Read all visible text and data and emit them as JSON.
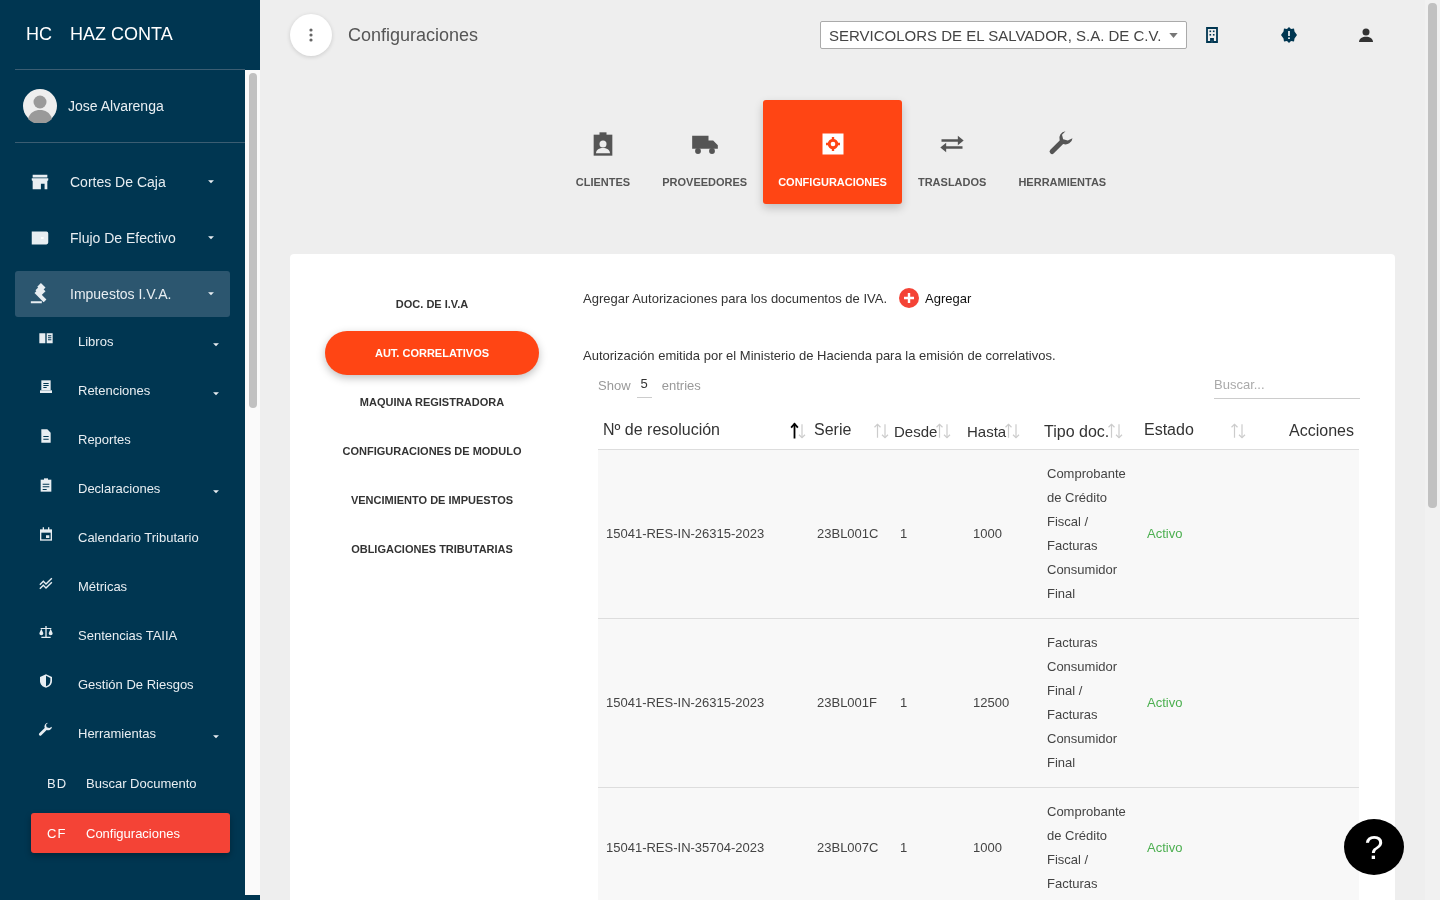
{
  "sidebar": {
    "brand": {
      "abbr": "HC",
      "name": "HAZ CONTA"
    },
    "user": {
      "name": "Jose Alvarenga"
    },
    "menu": [
      {
        "label": "Cortes De Caja",
        "expandable": true,
        "selected": false
      },
      {
        "label": "Flujo De Efectivo",
        "expandable": true,
        "selected": false
      },
      {
        "label": "Impuestos I.V.A.",
        "expandable": true,
        "selected": true,
        "children": [
          {
            "label": "Libros",
            "expandable": true,
            "selected": false
          },
          {
            "label": "Retenciones",
            "expandable": true,
            "selected": false
          },
          {
            "label": "Reportes",
            "expandable": false,
            "selected": false
          },
          {
            "label": "Declaraciones",
            "expandable": true,
            "selected": false
          },
          {
            "label": "Calendario Tributario",
            "expandable": false,
            "selected": false
          },
          {
            "label": "Métricas",
            "expandable": false,
            "selected": false
          },
          {
            "label": "Sentencias TAIIA",
            "expandable": false,
            "selected": false
          },
          {
            "label": "Gestión De Riesgos",
            "expandable": false,
            "selected": false
          },
          {
            "label": "Herramientas",
            "expandable": true,
            "selected": false,
            "children": [
              {
                "abbr": "BD",
                "label": "Buscar Documento",
                "selected": false
              },
              {
                "abbr": "CF",
                "label": "Configuraciones",
                "selected": true
              }
            ]
          }
        ]
      }
    ]
  },
  "header": {
    "title": "Configuraciones",
    "company": "SERVICOLORS DE EL SALVADOR, S.A. DE C.V."
  },
  "tabs": [
    {
      "label": "CLIENTES",
      "selected": false
    },
    {
      "label": "PROVEEDORES",
      "selected": false
    },
    {
      "label": "CONFIGURACIONES",
      "selected": true
    },
    {
      "label": "TRASLADOS",
      "selected": false
    },
    {
      "label": "HERRAMIENTAS",
      "selected": false
    }
  ],
  "subnav": [
    {
      "label": "DOC. DE I.V.A",
      "selected": false
    },
    {
      "label": "AUT. CORRELATIVOS",
      "selected": true
    },
    {
      "label": "MAQUINA REGISTRADORA",
      "selected": false
    },
    {
      "label": "CONFIGURACIONES DE MODULO",
      "selected": false
    },
    {
      "label": "VENCIMIENTO DE IMPUESTOS",
      "selected": false
    },
    {
      "label": "OBLIGACIONES TRIBUTARIAS",
      "selected": false
    }
  ],
  "content": {
    "intro": "Agregar Autorizaciones para los documentos de IVA.",
    "add_button": "Agregar",
    "description": "Autorización emitida por el Ministerio de Hacienda para la emisión de correlativos.",
    "show": {
      "label": "Show",
      "value": "5",
      "suffix": "entries"
    },
    "search": {
      "placeholder": "Buscar..."
    },
    "table": {
      "columns": [
        {
          "label": "Nº de resolución",
          "sortable": true,
          "sorted": true
        },
        {
          "label": "Serie",
          "sortable": true,
          "sorted": false
        },
        {
          "label": "Desde",
          "sortable": true,
          "sorted": false
        },
        {
          "label": "Hasta",
          "sortable": true,
          "sorted": false
        },
        {
          "label": "Tipo doc.",
          "sortable": true,
          "sorted": false
        },
        {
          "label": "Estado",
          "sortable": true,
          "sorted": false
        },
        {
          "label": "Acciones",
          "sortable": false
        }
      ],
      "rows": [
        {
          "resolution": "15041-RES-IN-26315-2023",
          "series": "23BL001C",
          "from": "1",
          "to": "1000",
          "doc_type": "Comprobante de Crédito Fiscal / Facturas Consumidor Final",
          "status": "Activo",
          "active": true
        },
        {
          "resolution": "15041-RES-IN-26315-2023",
          "series": "23BL001F",
          "from": "1",
          "to": "12500",
          "doc_type": "Facturas Consumidor Final / Facturas Consumidor Final",
          "status": "Activo",
          "active": true
        },
        {
          "resolution": "15041-RES-IN-35704-2023",
          "series": "23BL007C",
          "from": "1",
          "to": "1000",
          "doc_type": "Comprobante de Crédito Fiscal / Facturas",
          "status": "Activo",
          "active": true
        }
      ]
    }
  },
  "help_button": "?"
}
